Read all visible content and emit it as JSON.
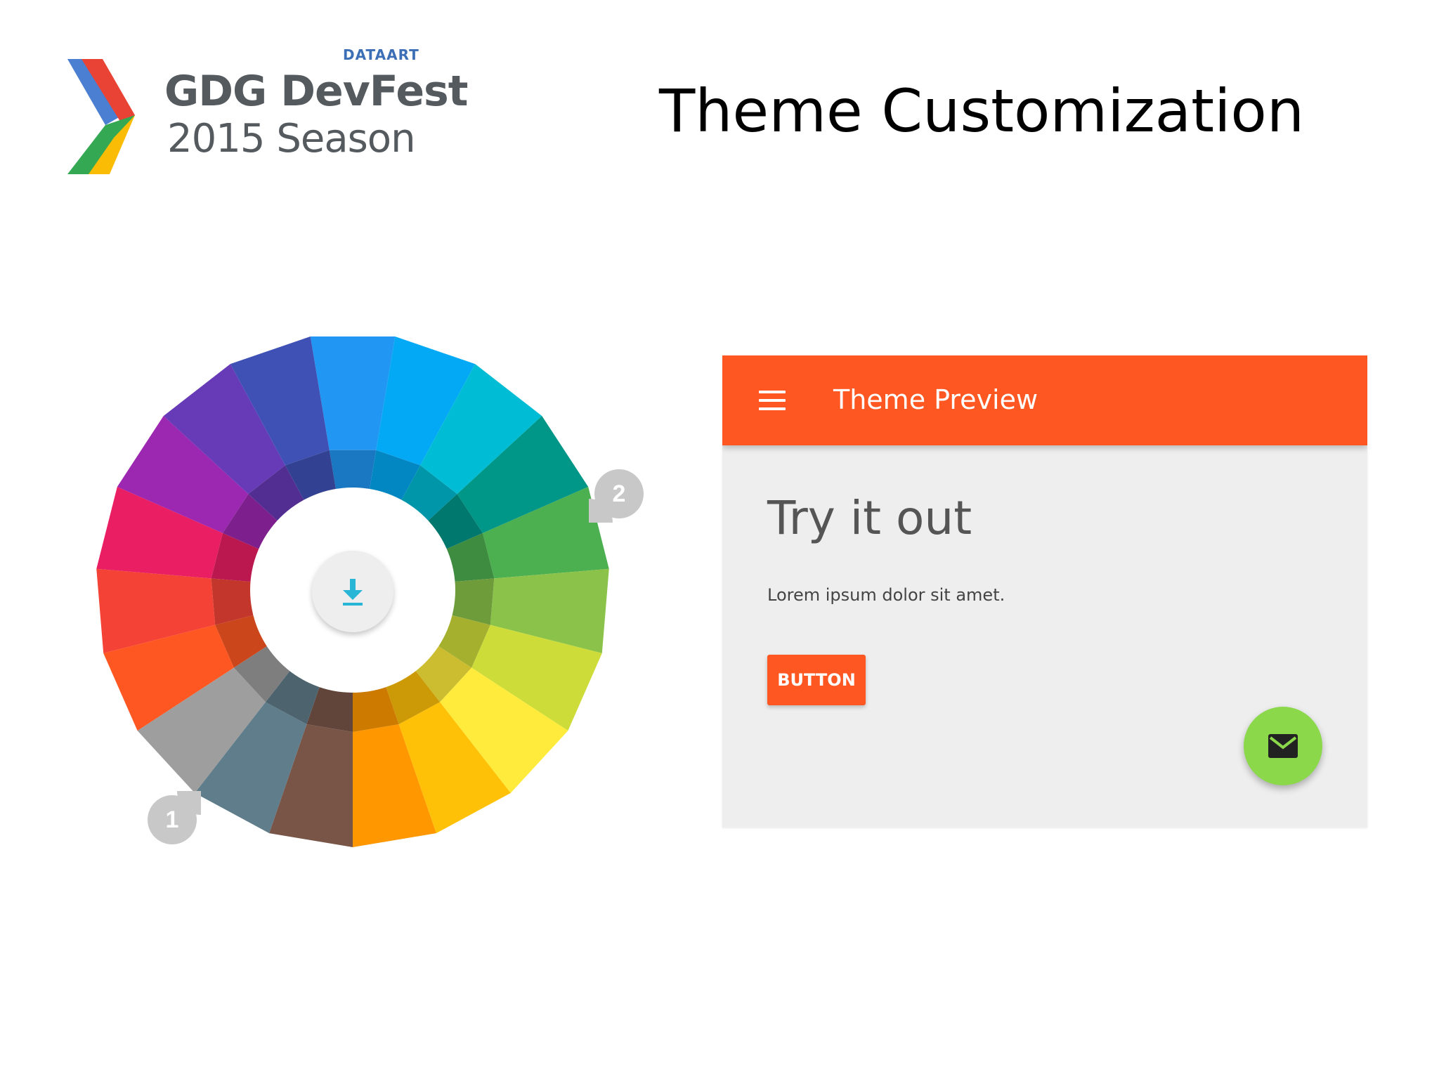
{
  "branding": {
    "sponsor": "DATAART",
    "title": "GDG DevFest",
    "subtitle": "2015 Season",
    "logo_icon": "gdg-chevron-logo-icon",
    "colors": {
      "blue": "#4a7fd1",
      "red": "#e94335",
      "green": "#34a853",
      "yellow": "#fbbc05"
    }
  },
  "slide": {
    "title": "Theme Customization"
  },
  "color_wheel": {
    "callouts": [
      {
        "label": "1"
      },
      {
        "label": "2"
      }
    ],
    "center_icon": "download-icon",
    "swatches": [
      "#2196f3",
      "#03a9f4",
      "#00bcd4",
      "#009688",
      "#4caf50",
      "#8bc34a",
      "#cddc39",
      "#ffeb3b",
      "#ffc107",
      "#ff9800",
      "#795548",
      "#607d8b",
      "#9e9e9e",
      "#ff5722",
      "#f44336",
      "#e91e63",
      "#9c27b0",
      "#673ab7",
      "#3f51b5"
    ]
  },
  "preview": {
    "app_bar": {
      "title": "Theme Preview",
      "menu_icon": "hamburger-menu-icon",
      "color": "#ff5722"
    },
    "headline": "Try it out",
    "body": "Lorem ipsum dolor sit amet.",
    "button_label": "BUTTON",
    "fab": {
      "icon": "mail-icon",
      "color": "#8bd94a"
    }
  }
}
